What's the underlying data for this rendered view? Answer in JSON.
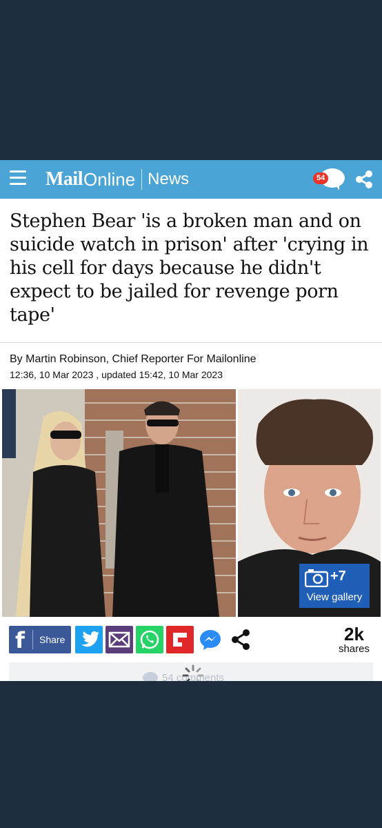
{
  "header": {
    "logo_mail": "Mail",
    "logo_online": "Online",
    "section": "News",
    "comment_count": "54",
    "accent_color": "#4ba4d6"
  },
  "article": {
    "headline": "Stephen Bear 'is a broken man and on suicide watch in prison' after 'crying in his cell for days because he didn't expect to be jailed for revenge porn tape'",
    "byline": "By Martin Robinson, Chief Reporter For Mailonline",
    "dateline": "12:36, 10 Mar 2023 , updated 15:42, 10 Mar 2023"
  },
  "gallery": {
    "count": "+7",
    "label": "View gallery"
  },
  "share": {
    "facebook_label": "Share",
    "shares_count": "2k",
    "shares_label": "shares",
    "icons": [
      "facebook-icon",
      "twitter-icon",
      "email-icon",
      "whatsapp-icon",
      "flipboard-icon",
      "messenger-icon",
      "share-icon"
    ]
  },
  "comments": {
    "count_text": "54 comments"
  }
}
